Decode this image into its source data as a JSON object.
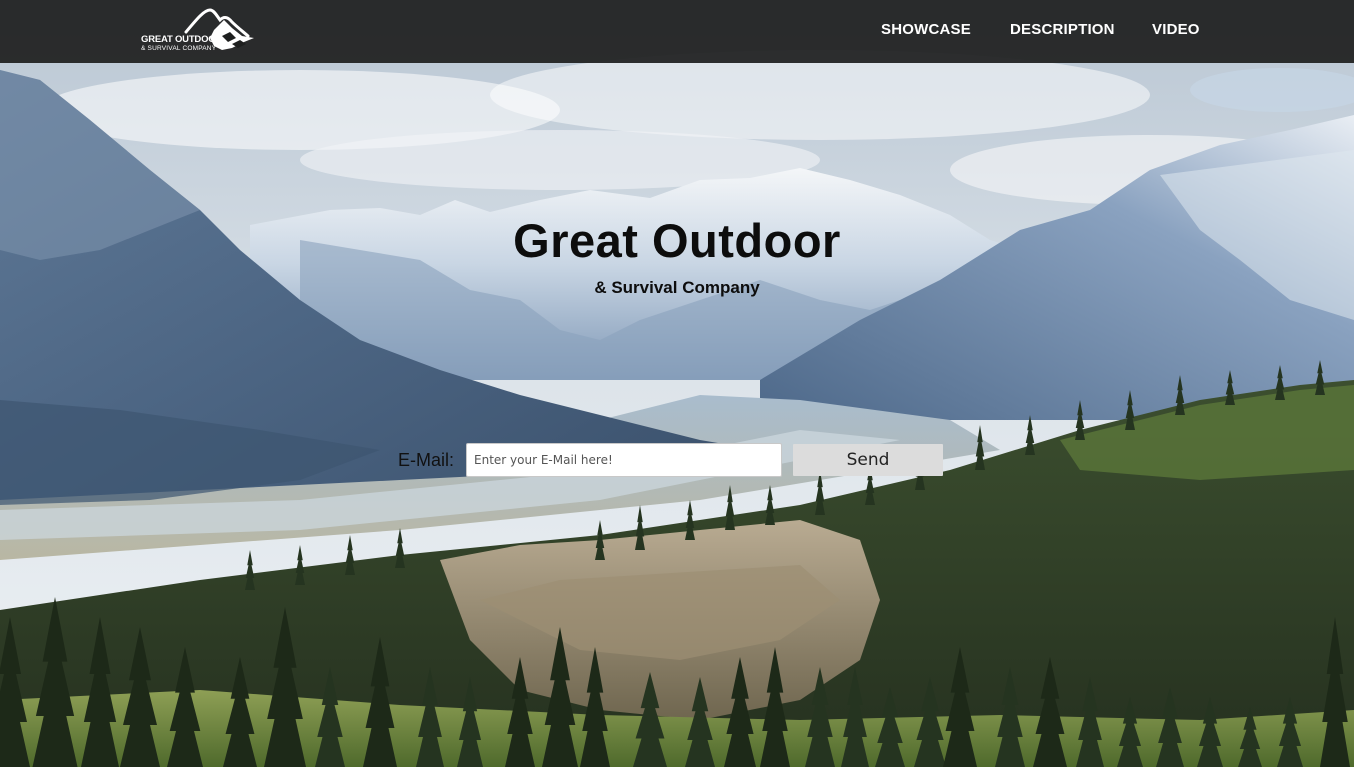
{
  "header": {
    "logo": {
      "line1": "GREAT OUTDOOR",
      "line2": "& SURVIVAL COMPANY",
      "icon": "mountain-logo-icon"
    },
    "nav": [
      {
        "label": "SHOWCASE"
      },
      {
        "label": "DESCRIPTION"
      },
      {
        "label": "VIDEO"
      }
    ]
  },
  "hero": {
    "title": "Great Outdoor",
    "subtitle": "& Survival Company",
    "background": "mountain-valley-landscape"
  },
  "signup": {
    "label": "E-Mail:",
    "input_value": "",
    "input_placeholder": "Enter your E-Mail here!",
    "button_label": "Send"
  },
  "colors": {
    "navbar": "#1e1f1f",
    "nav_text": "#ffffff",
    "title_text": "#0d0d0d",
    "button_bg": "#dcdcdc"
  }
}
